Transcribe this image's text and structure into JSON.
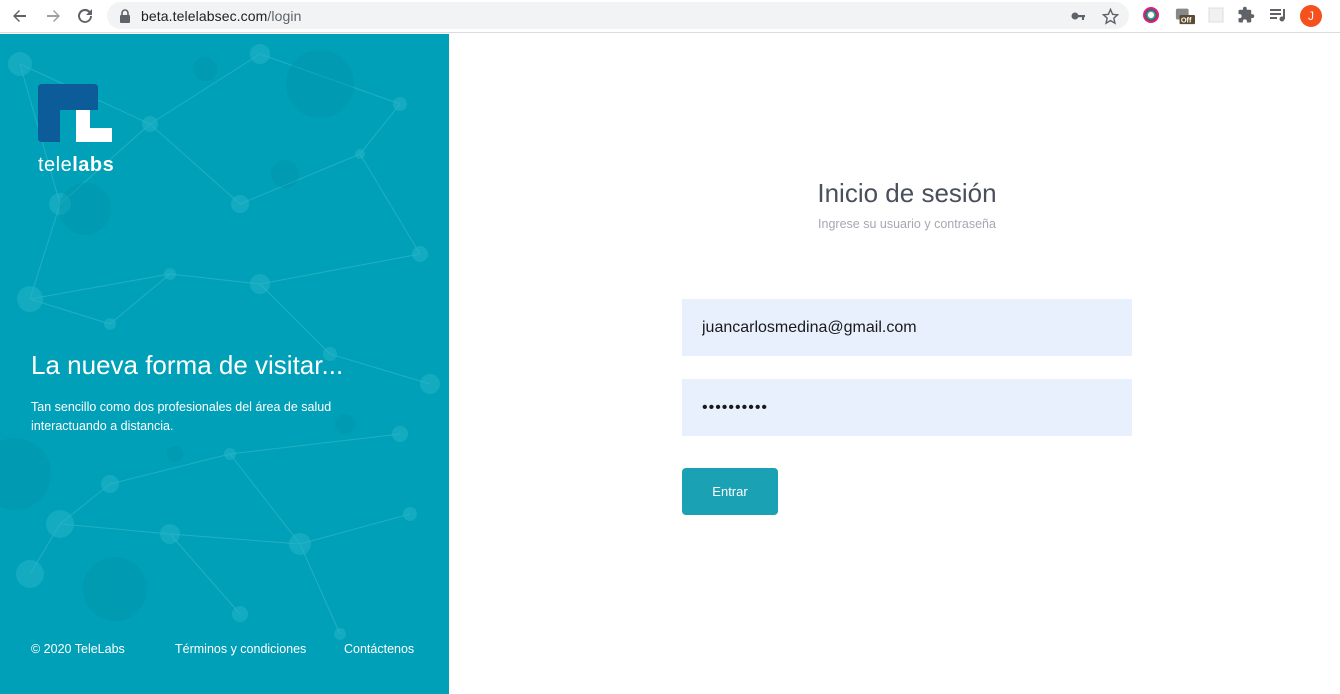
{
  "browser": {
    "url_host": "beta.telelabsec.com",
    "url_path": "/login",
    "avatar_initial": "J",
    "icons": [
      "back-icon",
      "forward-icon",
      "reload-icon",
      "lock-icon",
      "key-icon",
      "star-icon",
      "colorpicker-extension-icon",
      "off-extension-icon",
      "blank-extension-icon",
      "puzzle-icon",
      "media-icon"
    ]
  },
  "sidebar": {
    "brand_prefix": "tele",
    "brand_suffix": "labs",
    "headline": "La nueva forma de visitar...",
    "tagline": "Tan sencillo como dos profesionales del área de salud interactuando a distancia.",
    "footer": {
      "copyright": "© 2020 TeleLabs",
      "terms": "Términos y condiciones",
      "contact": "Contáctenos"
    }
  },
  "login": {
    "title": "Inicio de sesión",
    "subtitle": "Ingrese su usuario y contraseña",
    "email_value": "juancarlosmedina@gmail.com",
    "password_value": "**********",
    "submit_label": "Entrar"
  },
  "colors": {
    "panel": "#00a0b8",
    "button": "#1aa1b4",
    "input_bg": "#e8f0fe"
  }
}
